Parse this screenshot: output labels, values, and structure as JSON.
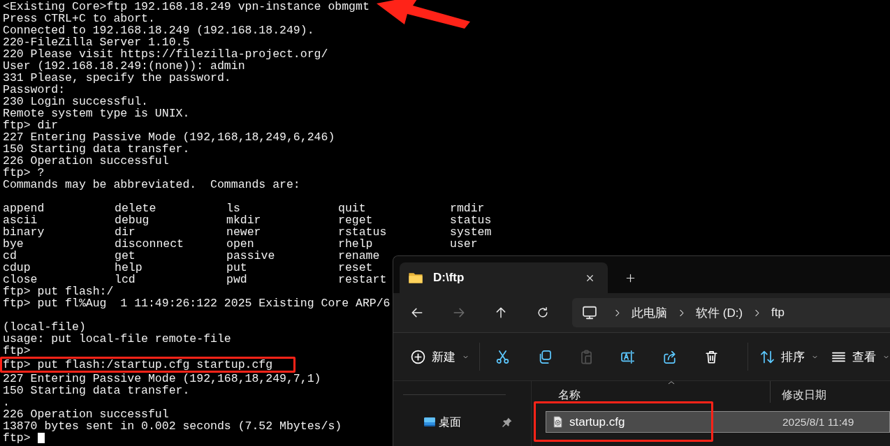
{
  "terminal": {
    "lines": [
      {
        "kind": "text",
        "text": "<Existing Core>ftp 192.168.18.249 vpn-instance obmgmt",
        "pointed_at": true
      },
      {
        "kind": "text",
        "text": "Press CTRL+C to abort."
      },
      {
        "kind": "text",
        "text": "Connected to 192.168.18.249 (192.168.18.249)."
      },
      {
        "kind": "text",
        "text": "220-FileZilla Server 1.10.5"
      },
      {
        "kind": "text",
        "text": "220 Please visit https://filezilla-project.org/"
      },
      {
        "kind": "text",
        "text": "User (192.168.18.249:(none)): admin"
      },
      {
        "kind": "text",
        "text": "331 Please, specify the password."
      },
      {
        "kind": "text",
        "text": "Password:"
      },
      {
        "kind": "text",
        "text": "230 Login successful."
      },
      {
        "kind": "text",
        "text": "Remote system type is UNIX."
      },
      {
        "kind": "text",
        "text": "ftp> dir"
      },
      {
        "kind": "text",
        "text": "227 Entering Passive Mode (192,168,18,249,6,246)"
      },
      {
        "kind": "text",
        "text": "150 Starting data transfer."
      },
      {
        "kind": "text",
        "text": "226 Operation successful"
      },
      {
        "kind": "text",
        "text": "ftp> ?"
      },
      {
        "kind": "text",
        "text": "Commands may be abbreviated.  Commands are:"
      },
      {
        "kind": "blank"
      },
      {
        "kind": "commands",
        "rows": [
          [
            "append",
            "delete",
            "ls",
            "quit",
            "rmdir"
          ],
          [
            "ascii",
            "debug",
            "mkdir",
            "reget",
            "status"
          ],
          [
            "binary",
            "dir",
            "newer",
            "rstatus",
            "system"
          ],
          [
            "bye",
            "disconnect",
            "open",
            "rhelp",
            "user"
          ],
          [
            "cd",
            "get",
            "passive",
            "rename"
          ],
          [
            "cdup",
            "help",
            "put",
            "reset"
          ],
          [
            "close",
            "lcd",
            "pwd",
            "restart"
          ]
        ]
      },
      {
        "kind": "text",
        "text": "ftp> put flash:/"
      },
      {
        "kind": "text",
        "text": "ftp> put fl%Aug  1 11:49:26:122 2025 Existing Core ARP/6"
      },
      {
        "kind": "blank"
      },
      {
        "kind": "text",
        "text": "(local-file)"
      },
      {
        "kind": "text",
        "text": "usage: put local-file remote-file"
      },
      {
        "kind": "text",
        "text": "ftp>"
      },
      {
        "kind": "text",
        "text": "ftp> put flash:/startup.cfg startup.cfg",
        "highlighted": true
      },
      {
        "kind": "text",
        "text": "227 Entering Passive Mode (192,168,18,249,7,1)"
      },
      {
        "kind": "text",
        "text": "150 Starting data transfer."
      },
      {
        "kind": "text",
        "text": "."
      },
      {
        "kind": "text",
        "text": "226 Operation successful"
      },
      {
        "kind": "text",
        "text": "13870 bytes sent in 0.002 seconds (7.52 Mbytes/s)"
      },
      {
        "kind": "prompt",
        "text": "ftp> ",
        "cursor": true
      }
    ]
  },
  "explorer": {
    "tabs": [
      {
        "title": "D:\\ftp",
        "selected": true
      }
    ],
    "nav": [
      {
        "kind": "back",
        "disabled": false
      },
      {
        "kind": "forward",
        "disabled": true
      },
      {
        "kind": "up",
        "disabled": false
      },
      {
        "kind": "refresh",
        "disabled": false
      }
    ],
    "breadcrumbs": [
      "此电脑",
      "软件 (D:)",
      "ftp"
    ],
    "toolbar": [
      {
        "kind": "new",
        "label": "新建",
        "disabled": false
      },
      {
        "kind": "divider"
      },
      {
        "kind": "cut",
        "disabled": false
      },
      {
        "kind": "copy",
        "disabled": false
      },
      {
        "kind": "paste",
        "disabled": true
      },
      {
        "kind": "rename",
        "disabled": false
      },
      {
        "kind": "share",
        "disabled": false
      },
      {
        "kind": "delete",
        "disabled": false
      },
      {
        "kind": "divider"
      },
      {
        "kind": "sort",
        "label": "排序",
        "disabled": false
      },
      {
        "kind": "view",
        "label": "查看",
        "disabled": false
      }
    ],
    "sidebar": [
      {
        "label": "桌面",
        "pinned": true
      }
    ],
    "columns": [
      {
        "label": "名称",
        "sorted": true
      },
      {
        "label": "修改日期",
        "sorted": false
      }
    ],
    "files": [
      {
        "name": "startup.cfg",
        "modified": "2025/8/1 11:49",
        "selected": true,
        "highlighted": true
      }
    ]
  }
}
